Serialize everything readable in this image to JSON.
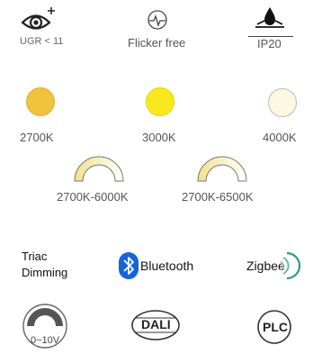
{
  "features": {
    "ugr": "UGR < 11",
    "flicker": "Flicker free",
    "ip": "IP20"
  },
  "temperatures": [
    {
      "label": "2700K",
      "color": "#F0C33C"
    },
    {
      "label": "3000K",
      "color": "#FAE81E"
    },
    {
      "label": "4000K",
      "color": "#FDF8E1"
    }
  ],
  "tunable": [
    {
      "label": "2700K-6000K"
    },
    {
      "label": "2700K-6500K"
    }
  ],
  "dimming": {
    "triac": "Triac\nDimming",
    "bluetooth": "Bluetooth",
    "zigbee": "Zigbee",
    "analog": "0~10V",
    "dali": "DALI",
    "plc": "PLC"
  },
  "colors": {
    "bluetooth": "#1565D8",
    "zigbee_accent": "#2E9E78"
  }
}
